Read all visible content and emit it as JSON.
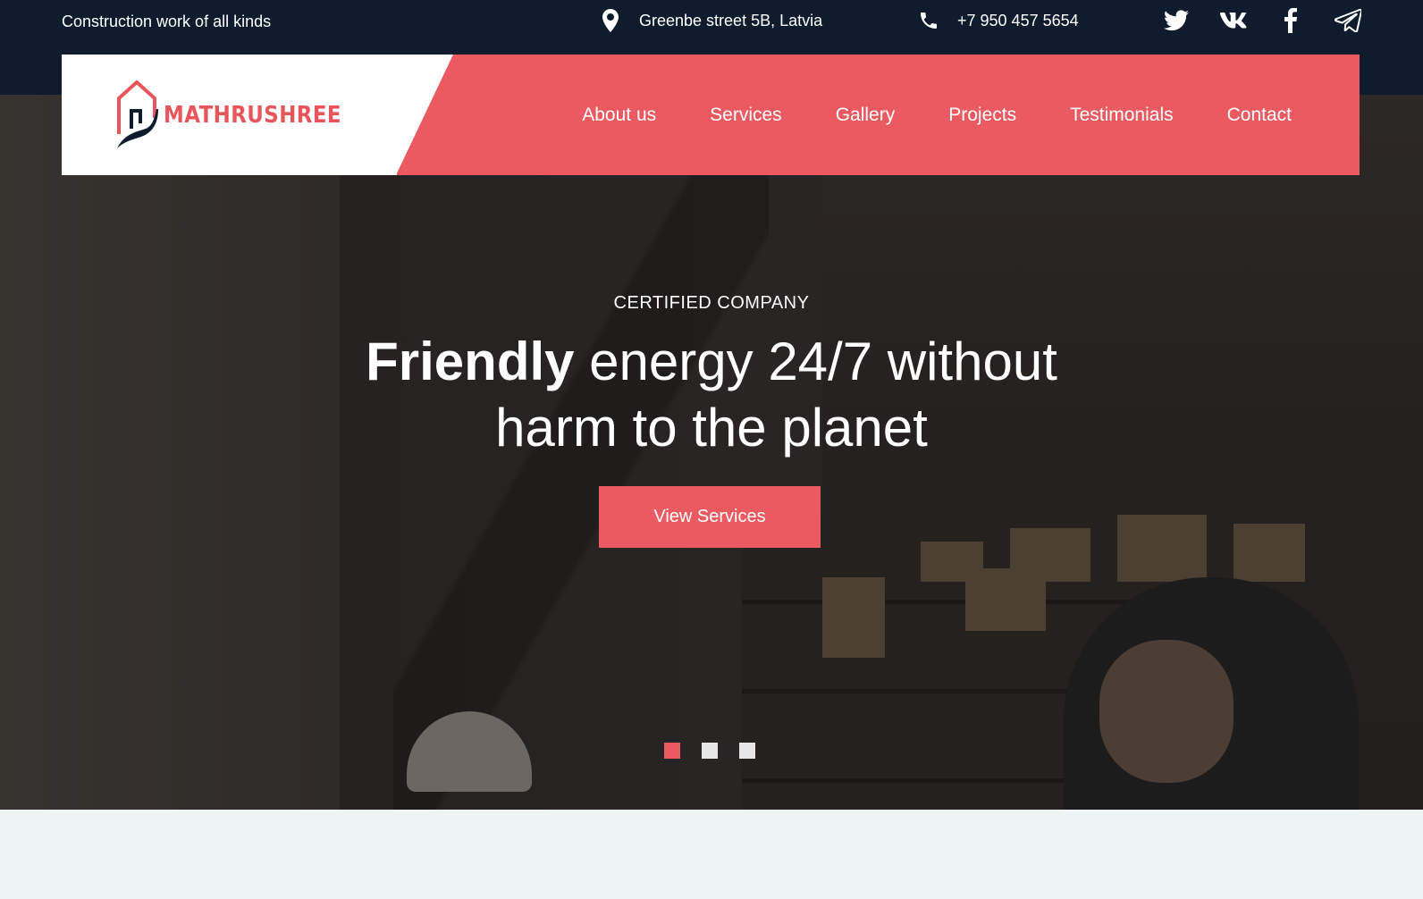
{
  "topbar": {
    "tagline": "Construction work of all kinds",
    "address": "Greenbe street 5B, Latvia",
    "phone": "+7 950 457 5654",
    "social": [
      "twitter-icon",
      "vk-icon",
      "facebook-icon",
      "telegram-icon"
    ]
  },
  "brand": {
    "name": "MATHRUSHREE",
    "accent": "#ea5a60",
    "dark": "#0e1c2e"
  },
  "nav": {
    "items": [
      {
        "label": "About us"
      },
      {
        "label": "Services"
      },
      {
        "label": "Gallery"
      },
      {
        "label": "Projects"
      },
      {
        "label": "Testimonials"
      },
      {
        "label": "Contact"
      }
    ]
  },
  "hero": {
    "eyebrow": "CERTIFIED COMPANY",
    "headline_bold": "Friendly",
    "headline_rest_line1": " energy 24/7 without",
    "headline_line2": "harm to the planet",
    "cta_label": "View Services",
    "slides": {
      "count": 3,
      "active": 1
    }
  }
}
